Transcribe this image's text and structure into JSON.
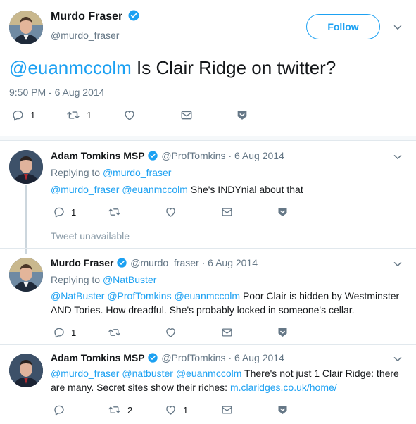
{
  "main_tweet": {
    "author_name": "Murdo Fraser",
    "author_handle": "@murdo_fraser",
    "follow_label": "Follow",
    "mention": "@euanmccolm",
    "text": " Is Clair Ridge on twitter?",
    "timestamp": "9:50 PM - 6 Aug 2014",
    "reply_count": "1",
    "retweet_count": "1"
  },
  "replies": [
    {
      "author_name": "Adam Tomkins MSP",
      "author_handle": "@ProfTomkins",
      "date": "· 6 Aug 2014",
      "replying_to_label": "Replying to ",
      "replying_to": "@murdo_fraser",
      "mentions": "@murdo_fraser @euanmccolm",
      "text": " She's INDYnial about that",
      "reply_count": "1"
    },
    {
      "unavailable": "Tweet unavailable"
    },
    {
      "author_name": "Murdo Fraser",
      "author_handle": "@murdo_fraser",
      "date": "· 6 Aug 2014",
      "replying_to_label": "Replying to ",
      "replying_to": "@NatBuster",
      "mentions": "@NatBuster @ProfTomkins @euanmccolm",
      "text_line1": " Poor Clair is hidden by Westminster",
      "text_line2": "AND Tories. How dreadful. She's probably locked in someone's cellar.",
      "reply_count": "1"
    },
    {
      "author_name": "Adam Tomkins MSP",
      "author_handle": "@ProfTomkins",
      "date": "· 6 Aug 2014",
      "mentions": "@murdo_fraser @natbuster @euanmccolm",
      "text_line1": " There's not just 1 Clair Ridge: there",
      "text_line2_a": "are many. Secret sites show their riches: ",
      "link": "m.claridges.co.uk/home/",
      "retweet_count": "2",
      "like_count": "1"
    }
  ],
  "colors": {
    "accent": "#1da1f2",
    "muted": "#657786",
    "text": "#14171a",
    "border": "#e1e8ed"
  },
  "icons": [
    "verified-icon",
    "chevron-down-icon",
    "reply-icon",
    "retweet-icon",
    "like-icon",
    "dm-icon",
    "bookmark-icon"
  ]
}
